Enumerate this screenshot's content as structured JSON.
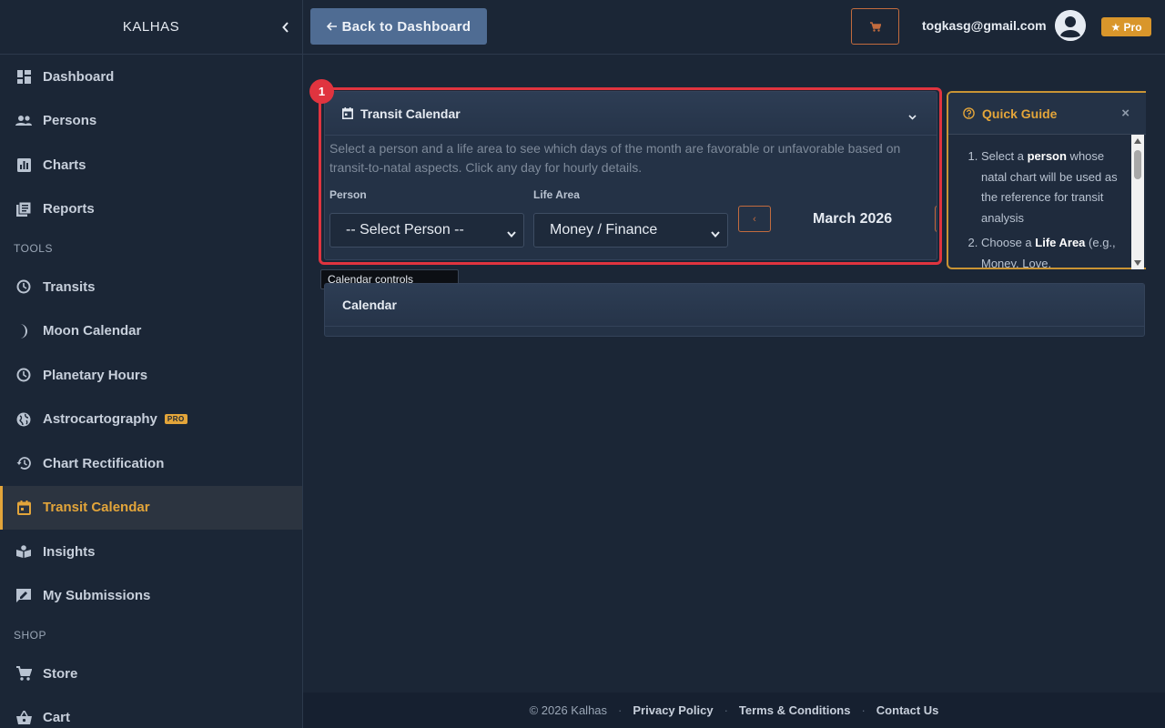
{
  "app": {
    "brand": "KALHAS"
  },
  "sidebar": {
    "main_items": [
      {
        "label": "Dashboard",
        "icon": "dashboard-icon"
      },
      {
        "label": "Persons",
        "icon": "people-icon"
      },
      {
        "label": "Charts",
        "icon": "bar-chart-icon"
      },
      {
        "label": "Reports",
        "icon": "reports-icon"
      }
    ],
    "tools_label": "TOOLS",
    "tools_items": [
      {
        "label": "Transits",
        "icon": "clock-icon"
      },
      {
        "label": "Moon Calendar",
        "icon": "moon-icon"
      },
      {
        "label": "Planetary Hours",
        "icon": "clock-icon"
      },
      {
        "label": "Astrocartography",
        "icon": "globe-icon",
        "badge": "PRO"
      },
      {
        "label": "Chart Rectification",
        "icon": "history-icon"
      },
      {
        "label": "Transit Calendar",
        "icon": "calendar-icon",
        "active": true
      },
      {
        "label": "Insights",
        "icon": "book-icon"
      },
      {
        "label": "My Submissions",
        "icon": "feedback-icon"
      }
    ],
    "shop_label": "SHOP",
    "shop_items": [
      {
        "label": "Store",
        "icon": "cart-icon"
      },
      {
        "label": "Cart",
        "icon": "basket-icon"
      }
    ]
  },
  "topbar": {
    "back_label": "Back to Dashboard",
    "user_email": "togkasg@gmail.com",
    "pro_label": "★ Pro"
  },
  "transit_card": {
    "marker": "1",
    "title": "Transit Calendar",
    "description": "Select a person and a life area to see which days of the month are favorable or unfavorable based on transit-to-natal aspects. Click any day for hourly details.",
    "person_label": "Person",
    "person_value": "-- Select Person --",
    "life_area_label": "Life Area",
    "life_area_value": "Money / Finance",
    "prev_label": "‹",
    "month": "March 2026",
    "tooltip": "Calendar controls"
  },
  "calendar_card": {
    "title": "Calendar"
  },
  "quick_guide": {
    "title": "Quick Guide",
    "close": "×",
    "step1_pre": "Select a ",
    "step1_bold": "person",
    "step1_post": " whose natal chart will be used as the reference for transit analysis",
    "step2_pre": "Choose a ",
    "step2_bold": "Life Area",
    "step2_post": " (e.g., Money, Love,"
  },
  "footer": {
    "copyright": "© 2026 Kalhas",
    "privacy": "Privacy Policy",
    "terms": "Terms & Conditions",
    "contact": "Contact Us"
  },
  "colors": {
    "background": "#1b2636",
    "accent": "#e3a53a",
    "highlight": "#e0343f",
    "back_button": "#4f6c93"
  }
}
